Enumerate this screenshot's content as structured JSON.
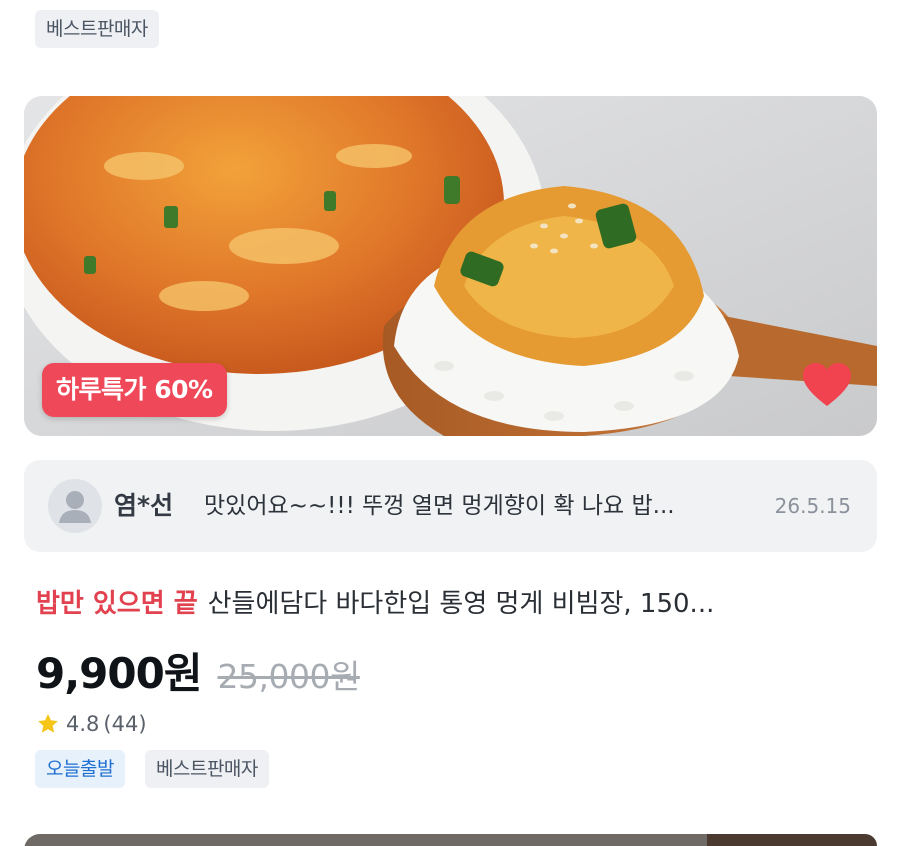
{
  "top_tag": "베스트판매자",
  "product": {
    "image_alt": "",
    "deal_badge": "하루특가 60%",
    "favorite_icon": "heart-icon",
    "highlight": "밥만 있으면 끝",
    "name": "산들에담다 바다한입 통영 멍게 비빔장, 150...",
    "sale_price": "9,900원",
    "original_price": "25,000원",
    "rating": "4.8",
    "rating_count": "(44)",
    "tags": [
      "오늘출발",
      "베스트판매자"
    ]
  },
  "review": {
    "avatar_icon": "user-avatar-icon",
    "author": "염*선",
    "text": "맛있어요~~!!! 뚜껑 열면 멍게향이 확 나요 밥...",
    "date": "26.5.15"
  },
  "colors": {
    "deal_red": "#ef4859",
    "highlight_red": "#e2424f",
    "tag_blue": "#1f6fd1",
    "star_yellow": "#f5c518"
  }
}
